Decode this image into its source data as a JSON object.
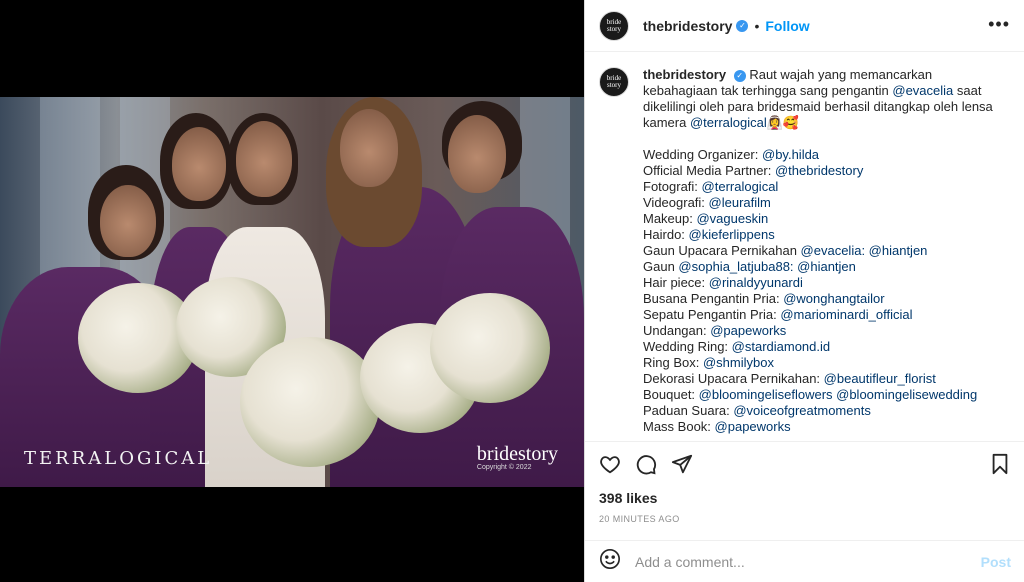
{
  "post": {
    "username": "thebridestory",
    "follow_label": "Follow",
    "separator": "•",
    "avatar_text": "bride story",
    "more_icon": "more-horizontal-icon",
    "verified_icon": "verified-badge-icon"
  },
  "media": {
    "watermark_left": "TERRALOGICAL",
    "watermark_right_brand": "bridestory",
    "watermark_right_copy": "Copyright © 2022"
  },
  "caption": {
    "username": "thebridestory",
    "text_1": "Raut wajah yang memancarkan kebahagiaan tak terhingga sang pengantin ",
    "mention_1": "@evacelia",
    "text_2": " saat dikelilingi oleh para bridesmaid berhasil ditangkap oleh lensa kamera ",
    "mention_2": "@terralogical",
    "emoji": "👰‍♀️🥰",
    "credits": [
      {
        "label": "Wedding Organizer: ",
        "mentions": "@by.hilda"
      },
      {
        "label": "Official Media Partner: ",
        "mentions": "@thebridestory"
      },
      {
        "label": "Fotografi: ",
        "mentions": "@terralogical"
      },
      {
        "label": "Videografi: ",
        "mentions": "@leurafilm"
      },
      {
        "label": "Makeup: ",
        "mentions": "@vagueskin"
      },
      {
        "label": "Hairdo: ",
        "mentions": "@kieferlippens"
      },
      {
        "label": "Gaun Upacara Pernikahan ",
        "mentions": "@evacelia: @hiantjen"
      },
      {
        "label": "Gaun ",
        "mentions": "@sophia_latjuba88: @hiantjen"
      },
      {
        "label": "Hair piece: ",
        "mentions": "@rinaldyyunardi"
      },
      {
        "label": "Busana Pengantin Pria: ",
        "mentions": "@wonghangtailor"
      },
      {
        "label": "Sepatu Pengantin Pria: ",
        "mentions": "@mariominardi_official"
      },
      {
        "label": "Undangan: ",
        "mentions": "@papeworks"
      },
      {
        "label": "Wedding Ring: ",
        "mentions": "@stardiamond.id"
      },
      {
        "label": "Ring Box: ",
        "mentions": "@shmilybox"
      },
      {
        "label": "Dekorasi Upacara Pernikahan: ",
        "mentions": "@beautifleur_florist"
      },
      {
        "label": "Bouquet: ",
        "mentions": "@bloomingeliseflowers @bloomingelisewedding"
      },
      {
        "label": "Paduan Suara: ",
        "mentions": "@voiceofgreatmoments"
      },
      {
        "label": "Mass Book: ",
        "mentions": "@papeworks"
      }
    ]
  },
  "engagement": {
    "likes": "398 likes",
    "time": "20 MINUTES AGO",
    "icons": [
      "heart-icon",
      "comment-icon",
      "share-icon",
      "bookmark-icon"
    ]
  },
  "comment": {
    "placeholder": "Add a comment...",
    "post_label": "Post",
    "emoji_icon": "smiley-icon"
  },
  "colors": {
    "link": "#00376b",
    "follow": "#0095f6",
    "verified": "#3897f0",
    "post_disabled": "#b2dffc",
    "muted": "#8e8e8e"
  }
}
